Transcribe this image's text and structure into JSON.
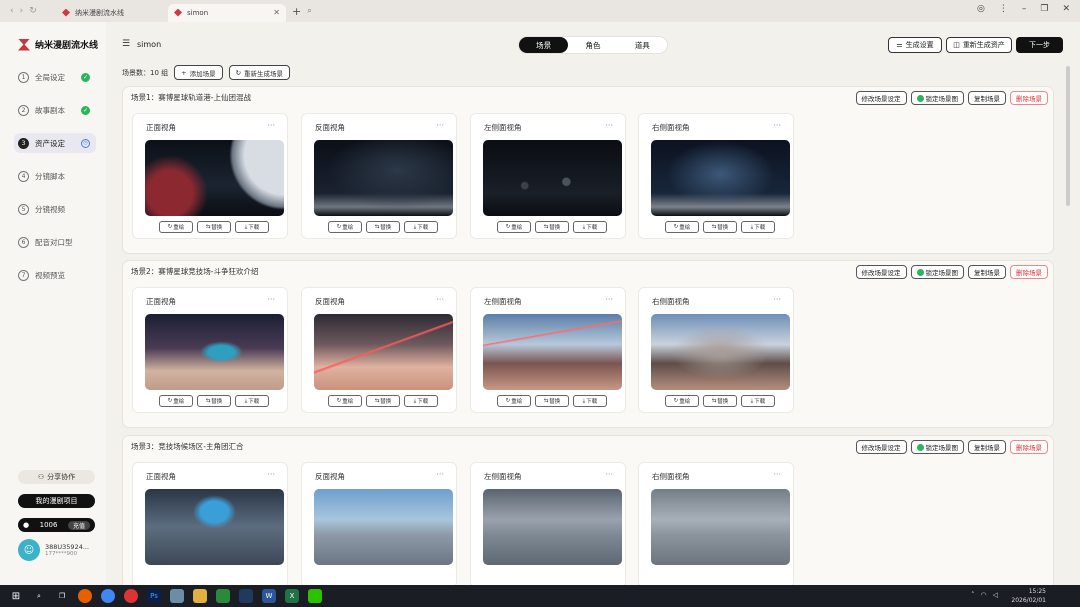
{
  "browser": {
    "tabs": [
      {
        "label": "纳米漫剧流水线"
      },
      {
        "label": "simon"
      }
    ]
  },
  "sidebar": {
    "brand": "纳米漫剧流水线",
    "steps": [
      {
        "num": "1",
        "label": "全局设定",
        "status": "done"
      },
      {
        "num": "2",
        "label": "故事剧本",
        "status": "done"
      },
      {
        "num": "3",
        "label": "资产设定",
        "status": "active"
      },
      {
        "num": "4",
        "label": "分镜脚本",
        "status": "pending"
      },
      {
        "num": "5",
        "label": "分镜视频",
        "status": "pending"
      },
      {
        "num": "6",
        "label": "配音对口型",
        "status": "pending"
      },
      {
        "num": "7",
        "label": "视频预览",
        "status": "pending"
      }
    ],
    "share_label": "分享协作",
    "dark_button_label": "我的漫剧项目",
    "credits": "1006",
    "credits_button": "充值",
    "user_name": "388U35924...",
    "user_phone": "177****900"
  },
  "topbar": {
    "project_name": "simon",
    "segments": [
      {
        "label": "场景",
        "active": true
      },
      {
        "label": "角色",
        "active": false
      },
      {
        "label": "道具",
        "active": false
      }
    ],
    "generate_settings_label": "生成设置",
    "regen_assets_label": "重新生成资产",
    "next_label": "下一步"
  },
  "scene_toolbar": {
    "count_text": "场景数：10 组",
    "add_label": "添加场景",
    "regen_label": "重新生成场景"
  },
  "panel_buttons": {
    "modify": "修改场景设定",
    "locked": "锁定场景图",
    "copy": "复制场景",
    "delete": "删除场景"
  },
  "card_actions": [
    "重绘",
    "替换",
    "下载"
  ],
  "scenes": [
    {
      "title": "场景1：赛博星球轨道港-上仙团混战",
      "views": [
        "正面视角",
        "反面视角",
        "左侧面视角",
        "右侧面视角"
      ]
    },
    {
      "title": "场景2：赛博星球竞技场-斗争狂欢介绍",
      "views": [
        "正面视角",
        "反面视角",
        "左侧面视角",
        "右侧面视角"
      ]
    },
    {
      "title": "场景3：竞技场候场区-主角团汇合",
      "views": [
        "正面视角",
        "反面视角",
        "左侧面视角",
        "右侧面视角"
      ]
    }
  ],
  "taskbar": {
    "time": "15:25",
    "date": "2026/02/01"
  }
}
